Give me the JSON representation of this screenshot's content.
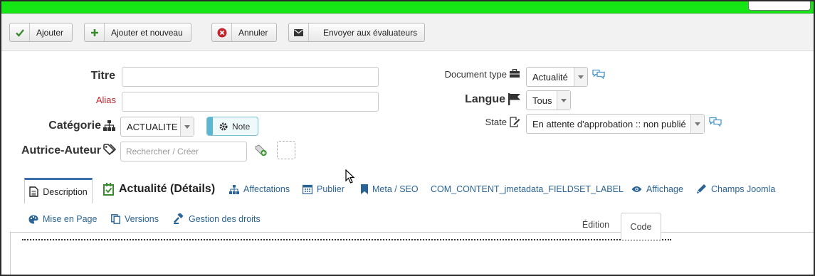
{
  "toolbar": {
    "buttons": [
      {
        "label": "Ajouter",
        "icon": "check-icon",
        "color": "#3a8b2e"
      },
      {
        "label": "Ajouter et nouveau",
        "icon": "plus-icon",
        "color": "#3a8b2e"
      },
      {
        "label": "Annuler",
        "icon": "cancel-circle-icon",
        "color": "#c0262c"
      },
      {
        "label": "Envoyer aux évaluateurs",
        "icon": "envelope-icon",
        "color": "#333333"
      }
    ]
  },
  "form": {
    "title_label": "Titre",
    "title_value": "",
    "alias_label": "Alias",
    "alias_value": "",
    "category_label": "Catégorie",
    "category_value": "ACTUALITE",
    "note_label": "Note",
    "author_label": "Autrice-Auteur",
    "author_placeholder": "Rechercher / Créer",
    "doctype_label": "Document type",
    "doctype_value": "Actualité",
    "language_label": "Langue",
    "language_value": "Tous",
    "state_label": "State",
    "state_value": "En attente d'approbation :: non publié"
  },
  "tabs": {
    "row1": [
      {
        "label": "Description",
        "icon": "document-icon",
        "active": true
      },
      {
        "label": "Actualité (Détails)",
        "icon": "checkbox-icon"
      },
      {
        "label": "Affectations",
        "icon": "sitemap-icon"
      },
      {
        "label": "Publier",
        "icon": "calendar-icon"
      },
      {
        "label": "Meta / SEO",
        "icon": "bookmark-icon"
      },
      {
        "label": "COM_CONTENT_jmetadata_FIELDSET_LABEL",
        "icon": ""
      },
      {
        "label": "Affichage",
        "icon": "eye-icon"
      },
      {
        "label": "Champs Joomla",
        "icon": "pencil-icon"
      }
    ],
    "row2": [
      {
        "label": "Mise en Page",
        "icon": "palette-icon"
      },
      {
        "label": "Versions",
        "icon": "copy-icon"
      },
      {
        "label": "Gestion des droits",
        "icon": "gavel-icon"
      }
    ]
  },
  "editor": {
    "mode_edit": "Édition",
    "mode_code": "Code"
  },
  "colors": {
    "topbar": "#16e516",
    "link": "#2a6496",
    "required": "#c0262c",
    "active_tab_border": "#3c6fa7"
  }
}
